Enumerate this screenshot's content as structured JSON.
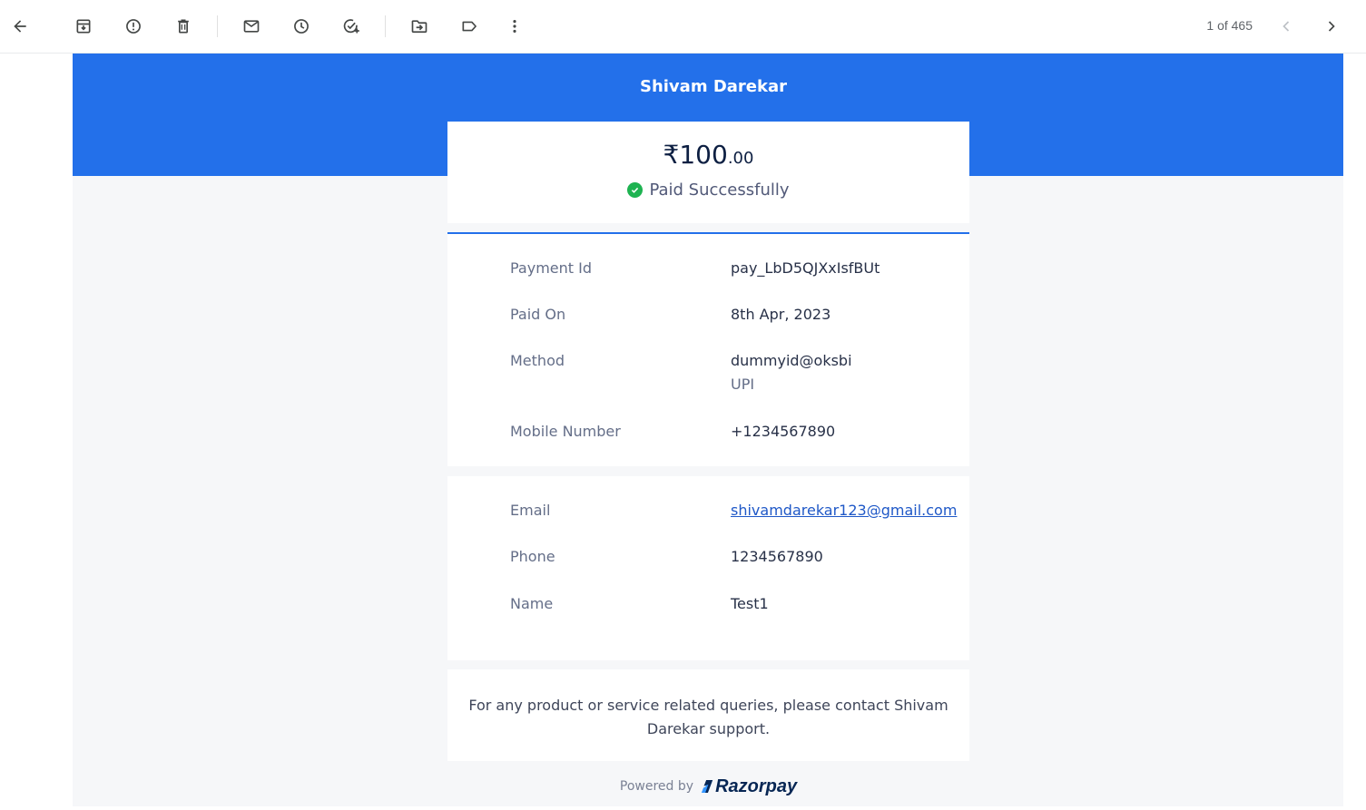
{
  "toolbar": {
    "icons": [
      "back-arrow-icon",
      "archive-icon",
      "report-spam-icon",
      "delete-icon",
      "mark-unread-icon",
      "snooze-icon",
      "add-task-icon",
      "move-to-icon",
      "label-icon",
      "more-vert-icon",
      "chevron-left-icon",
      "chevron-right-icon"
    ],
    "pager_text": "1 of 465"
  },
  "receipt": {
    "merchant_name": "Shivam Darekar",
    "amount_major": "₹100",
    "amount_minor": ".00",
    "status": "Paid Successfully",
    "details": [
      {
        "label": "Payment Id",
        "value": "pay_LbD5QJXxIsfBUt"
      },
      {
        "label": "Paid On",
        "value": "8th Apr, 2023"
      },
      {
        "label": "Method",
        "value": "dummyid@oksbi",
        "sub": "UPI"
      },
      {
        "label": "Mobile Number",
        "value": "+1234567890"
      }
    ],
    "contact": [
      {
        "label": "Email",
        "value": "shivamdarekar123@gmail.com"
      },
      {
        "label": "Phone",
        "value": "1234567890"
      },
      {
        "label": "Name",
        "value": "Test1"
      }
    ],
    "footer": "For any product or service related queries, please contact Shivam Darekar support.",
    "powered_by": "Powered by",
    "brand": "Razorpay"
  },
  "colors": {
    "banner": "#2370ea",
    "success": "#1eb351",
    "link": "#1f58c7",
    "brand": "#072654"
  }
}
